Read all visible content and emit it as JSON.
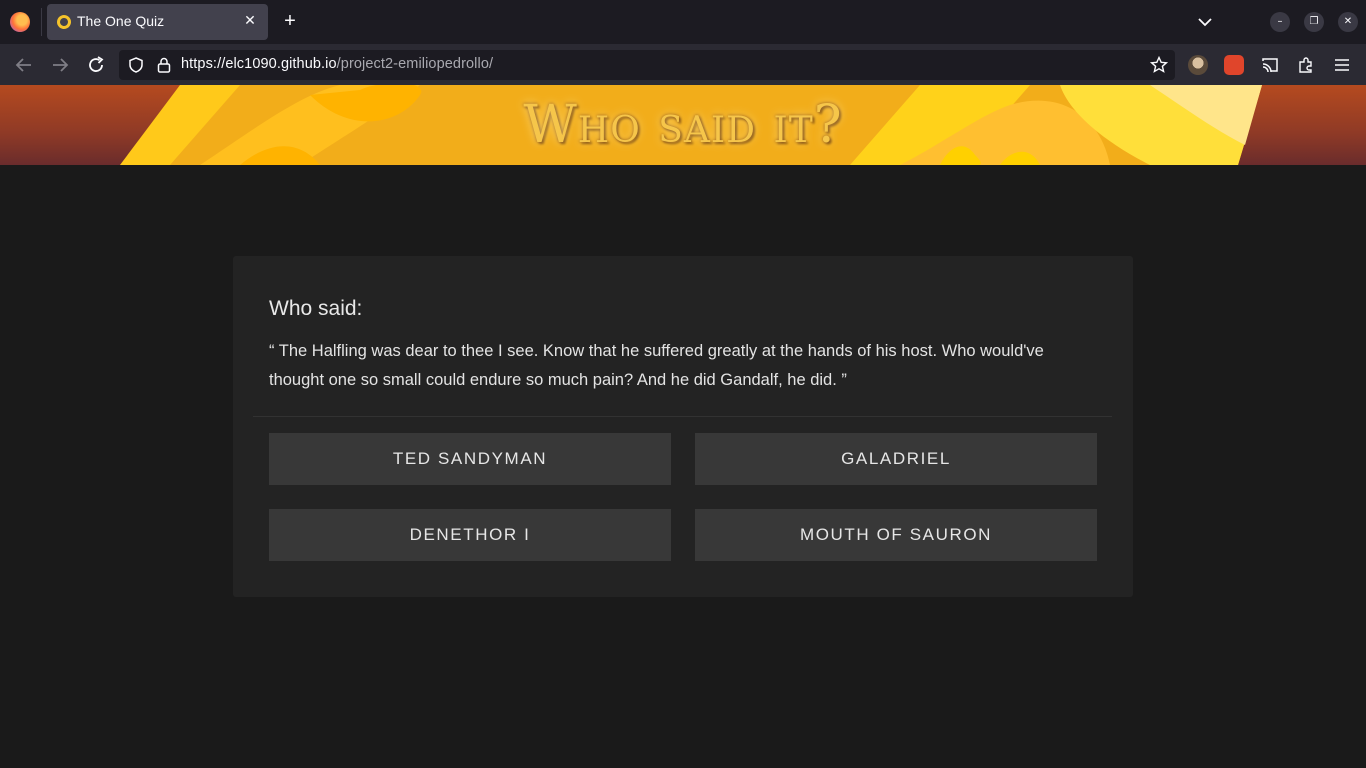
{
  "browser": {
    "tab_title": "The One Quiz",
    "url_host": "https://elc1090.github.io",
    "url_path": "/project2-emiliopedrollo/",
    "tab_close_glyph": "✕",
    "new_tab_glyph": "+",
    "win_minimize_glyph": "–",
    "win_restore_glyph": "❐",
    "win_close_glyph": "✕"
  },
  "banner": {
    "title": "Who said it?",
    "colors": {
      "gold": "#f6c64a",
      "rust": "#b54a1f"
    }
  },
  "quiz": {
    "question_label": "Who said:",
    "quote": "“ The Halfling was dear to thee I see. Know that he suffered greatly at the hands of his host. Who would've thought one so small could endure so much pain? And he did Gandalf, he did. ”",
    "answers": [
      "TED SANDYMAN",
      "GALADRIEL",
      "DENETHOR I",
      "MOUTH OF SAURON"
    ]
  },
  "icons": {
    "back": "arrow-left-icon",
    "forward": "arrow-right-icon",
    "reload": "reload-icon",
    "tracking": "shield-icon",
    "lock": "lock-icon",
    "bookmark": "star-icon",
    "extensions": "puzzle-icon",
    "menu": "hamburger-icon"
  }
}
